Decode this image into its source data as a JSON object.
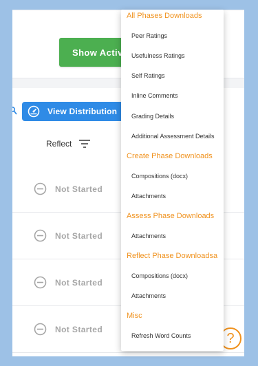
{
  "toolbar": {
    "show_active_label": "Show Active Only"
  },
  "grid": {
    "view_distribution_label": "View Distribution",
    "column_header": "Reflect",
    "rows": [
      {
        "status": "Not Started"
      },
      {
        "status": "Not Started"
      },
      {
        "status": "Not Started"
      },
      {
        "status": "Not Started"
      }
    ]
  },
  "help": {
    "label": "?"
  },
  "menu": {
    "sections": [
      {
        "title": "All Phases Downloads",
        "items": [
          "Peer Ratings",
          "Usefulness Ratings",
          "Self Ratings",
          "Inline Comments",
          "Grading Details",
          "Additional Assessment Details"
        ]
      },
      {
        "title": "Create Phase Downloads",
        "items": [
          "Compositions (docx)",
          "Attachments"
        ]
      },
      {
        "title": "Assess Phase Downloads",
        "items": [
          "Attachments"
        ]
      },
      {
        "title": "Reflect Phase Downloadsa",
        "items": [
          "Compositions (docx)",
          "Attachments"
        ]
      },
      {
        "title": "Misc",
        "items": [
          "Refresh Word Counts"
        ]
      }
    ]
  },
  "colors": {
    "background": "#9dc1e6",
    "accent_orange": "#f0921e",
    "primary_blue": "#2f8be6",
    "success_green": "#4caf50",
    "muted_gray": "#a6a6a6"
  },
  "icons": [
    "search-icon",
    "speedometer-icon",
    "filter-icon",
    "minus-circle-icon",
    "help-icon"
  ]
}
